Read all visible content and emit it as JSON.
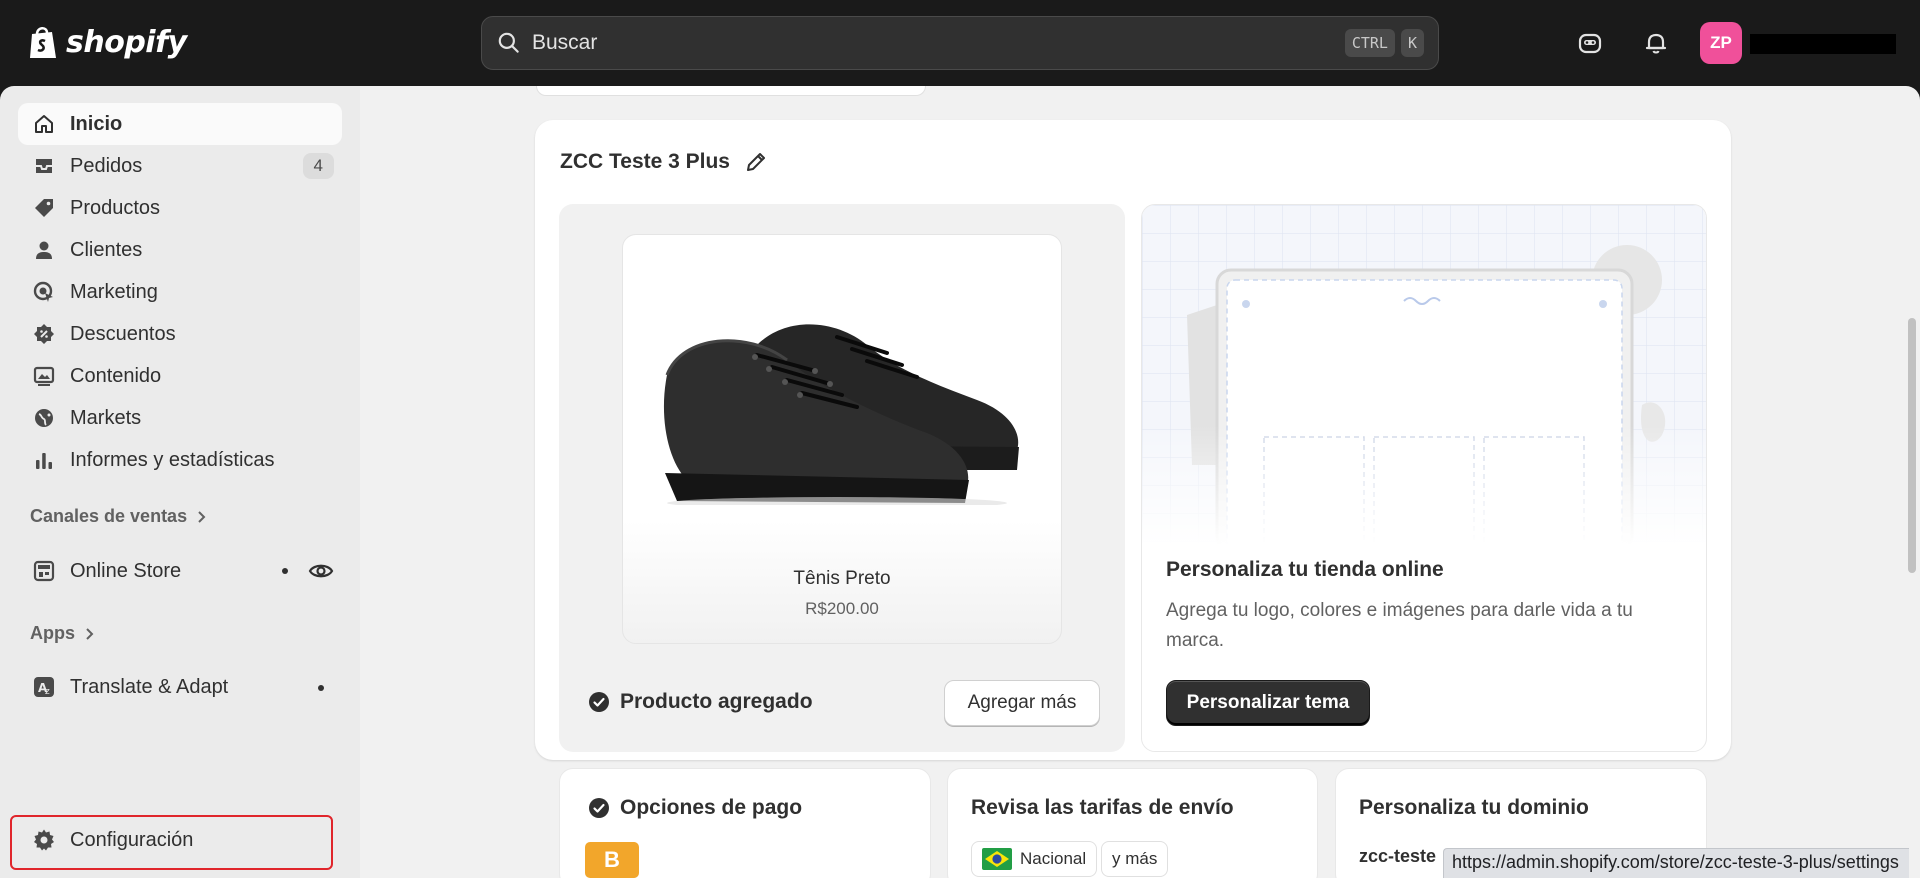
{
  "header": {
    "brand": "shopify",
    "search_placeholder": "Buscar",
    "shortcut_keys": [
      "CTRL",
      "K"
    ],
    "avatar_initials": "ZP"
  },
  "sidebar": {
    "items": [
      {
        "label": "Inicio",
        "icon": "home-icon"
      },
      {
        "label": "Pedidos",
        "icon": "inbox-icon",
        "badge": "4"
      },
      {
        "label": "Productos",
        "icon": "tag-icon"
      },
      {
        "label": "Clientes",
        "icon": "person-icon"
      },
      {
        "label": "Marketing",
        "icon": "target-icon"
      },
      {
        "label": "Descuentos",
        "icon": "discount-icon"
      },
      {
        "label": "Contenido",
        "icon": "image-icon"
      },
      {
        "label": "Markets",
        "icon": "globe-icon"
      },
      {
        "label": "Informes y estadísticas",
        "icon": "bar-chart-icon"
      }
    ],
    "sales_channels_label": "Canales de ventas",
    "online_store_label": "Online Store",
    "apps_label": "Apps",
    "translate_label": "Translate & Adapt",
    "settings_label": "Configuración"
  },
  "main": {
    "store_title": "ZCC Teste 3 Plus",
    "product": {
      "name": "Tênis Preto",
      "price": "R$200.00",
      "added_label": "Producto agregado",
      "add_more_label": "Agregar más"
    },
    "theme": {
      "heading": "Personaliza tu tienda online",
      "description": "Agrega tu logo, colores e imágenes para darle vida a tu marca.",
      "button_label": "Personalizar tema"
    },
    "payments": {
      "title": "Opciones de pago",
      "provider_logo": "B"
    },
    "shipping": {
      "title": "Revisa las tarifas de envío",
      "chip_national": "Nacional",
      "chip_more": "y más"
    },
    "domain": {
      "title": "Personaliza tu dominio",
      "value": "zcc-teste"
    }
  },
  "status_url": "https://admin.shopify.com/store/zcc-teste-3-plus/settings",
  "colors": {
    "accent_avatar": "#f0509a",
    "highlight_box": "#e0252b",
    "payment_logo": "#f2a62b"
  }
}
